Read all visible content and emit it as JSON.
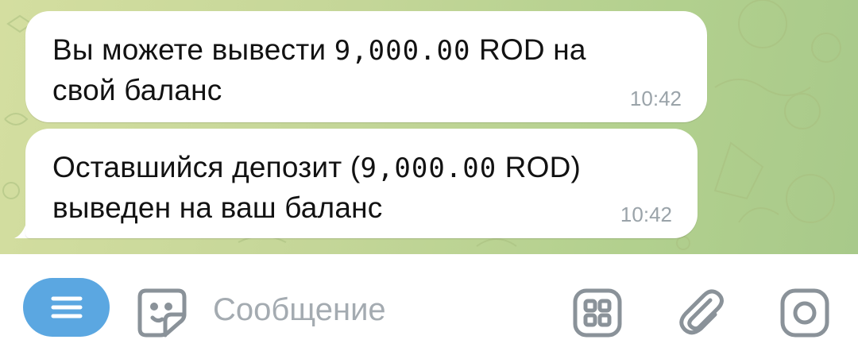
{
  "messages": [
    {
      "text_before": "Вы можете вывести ",
      "amount": "9,000.00",
      "text_after_1": " ROD на",
      "text_line2": "свой баланс",
      "time": "10:42"
    },
    {
      "text_before": "Оставшийся депозит (",
      "amount": "9,000.00",
      "text_after_1": " ROD)",
      "text_line2": "выведен на ваш баланс",
      "time": "10:42"
    }
  ],
  "composer": {
    "placeholder": "Сообщение",
    "icons": [
      "menu-icon",
      "sticker-icon",
      "bot-commands-icon",
      "attach-icon",
      "camera-icon"
    ]
  },
  "colors": {
    "menu_button": "#5ba7e1",
    "chat_bg": "#c4d698",
    "bubble": "#ffffff",
    "timestamp": "#9aa3a9",
    "icon_gray": "#8a9299"
  }
}
